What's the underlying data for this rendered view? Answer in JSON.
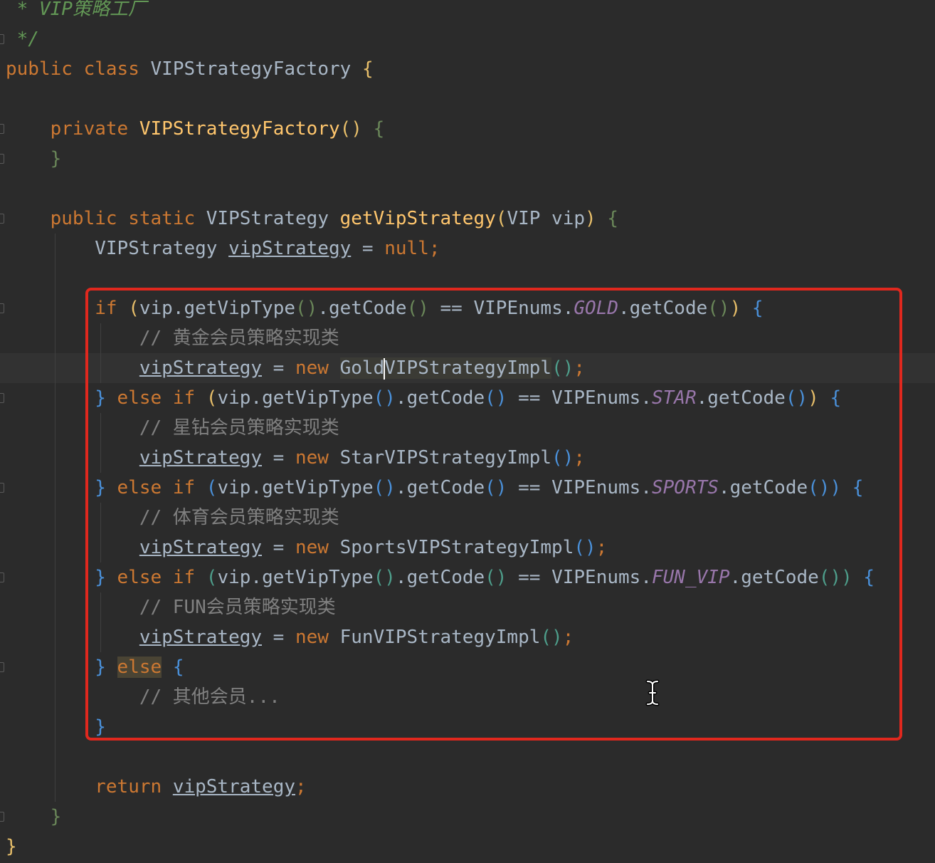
{
  "editor": {
    "language": "Java",
    "theme_colors": {
      "background": "#2b2b2b",
      "keyword": "#cc7832",
      "method": "#ffc66d",
      "comment": "#808080",
      "doc_comment": "#629755",
      "constant": "#9876aa",
      "text": "#a9b7c6",
      "highlight_box": "#e0281e"
    },
    "highlight_box_color": "#e0281e",
    "text_cursor_icon": "i-beam-cursor-icon"
  },
  "code": {
    "doc_line": " * VIP策略工厂",
    "doc_end": " */",
    "l_public": "public",
    "l_class": "class",
    "l_classname": "VIPStrategyFactory",
    "l_private": "private",
    "l_ctor": "VIPStrategyFactory",
    "l_static": "static",
    "l_rettype": "VIPStrategy",
    "l_method": "getVipStrategy",
    "l_param": "VIP vip",
    "l_var_type": "VIPStrategy",
    "l_var": "vipStrategy",
    "l_null": "null",
    "kw_if": "if",
    "kw_else": "else",
    "kw_new": "new",
    "kw_return": "return",
    "vip_access": "vip.getVipType",
    "get_code": "getCode",
    "enums": "VIPEnums",
    "c_gold": "GOLD",
    "c_star": "STAR",
    "c_sports": "SPORTS",
    "c_fun": "FUN_VIP",
    "cm_gold": "// 黄金会员策略实现类",
    "cm_star": "// 星钻会员策略实现类",
    "cm_sports": "// 体育会员策略实现类",
    "cm_fun": "// FUN会员策略实现类",
    "cm_other": "// 其他会员...",
    "impl_gold_a": "Gold",
    "impl_gold_b": "VIPStrategyImpl",
    "impl_star": "StarVIPStrategyImpl",
    "impl_sports": "SportsVIPStrategyImpl",
    "impl_fun": "FunVIPStrategyImpl"
  }
}
